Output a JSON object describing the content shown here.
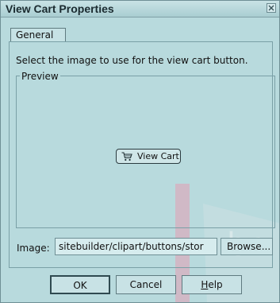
{
  "window": {
    "title": "View Cart Properties"
  },
  "tabs": [
    {
      "label": "General"
    }
  ],
  "instruction": "Select the image to use for the view cart button.",
  "preview": {
    "group_label": "Preview",
    "button_label": "View Cart",
    "button_icon": "shopping-cart-icon"
  },
  "image": {
    "label": "Image:",
    "value": "sitebuilder/clipart/buttons/stor",
    "browse_label": "Browse..."
  },
  "buttons": {
    "ok": "OK",
    "cancel": "Cancel",
    "help_first": "H",
    "help_rest": "elp"
  },
  "colors": {
    "background": "#b8dadd",
    "watermark": "#d8b3c6"
  }
}
